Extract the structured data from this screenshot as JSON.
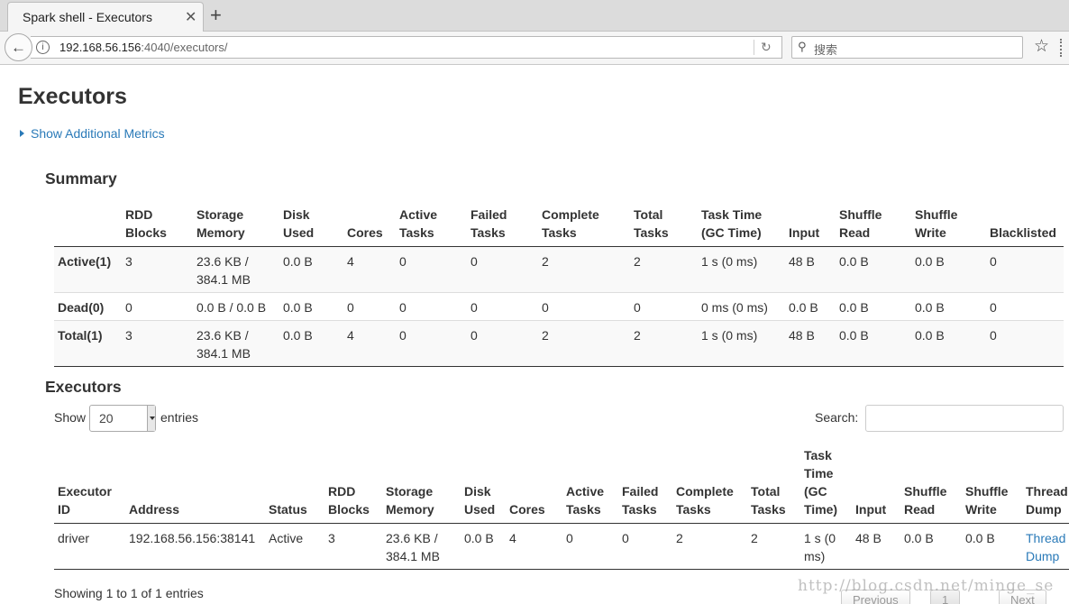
{
  "browser": {
    "tab_title": "Spark shell - Executors",
    "tab_close": "✕",
    "new_tab": "+",
    "url_host": "192.168.56.156",
    "url_path": ":4040/executors/",
    "search_placeholder": "搜索"
  },
  "page": {
    "title": "Executors",
    "show_additional_metrics": "Show Additional Metrics"
  },
  "summary": {
    "title": "Summary",
    "headers": [
      [
        "",
        ""
      ],
      [
        "RDD",
        "Blocks"
      ],
      [
        "Storage",
        "Memory"
      ],
      [
        "Disk",
        "Used"
      ],
      [
        "",
        "Cores"
      ],
      [
        "Active",
        "Tasks"
      ],
      [
        "Failed",
        "Tasks"
      ],
      [
        "Complete",
        "Tasks"
      ],
      [
        "Total",
        "Tasks"
      ],
      [
        "Task Time",
        "(GC Time)"
      ],
      [
        "",
        "Input"
      ],
      [
        "Shuffle",
        "Read"
      ],
      [
        "Shuffle",
        "Write"
      ],
      [
        "",
        "Blacklisted"
      ]
    ],
    "rows": [
      [
        "Active(1)",
        "3",
        "23.6 KB / 384.1 MB",
        "0.0 B",
        "4",
        "0",
        "0",
        "2",
        "2",
        "1 s (0 ms)",
        "48 B",
        "0.0 B",
        "0.0 B",
        "0"
      ],
      [
        "Dead(0)",
        "0",
        "0.0 B / 0.0 B",
        "0.0 B",
        "0",
        "0",
        "0",
        "0",
        "0",
        "0 ms (0 ms)",
        "0.0 B",
        "0.0 B",
        "0.0 B",
        "0"
      ],
      [
        "Total(1)",
        "3",
        "23.6 KB / 384.1 MB",
        "0.0 B",
        "4",
        "0",
        "0",
        "2",
        "2",
        "1 s (0 ms)",
        "48 B",
        "0.0 B",
        "0.0 B",
        "0"
      ]
    ]
  },
  "executors": {
    "title": "Executors",
    "show_label": "Show",
    "entries_value": "20",
    "entries_label": "entries",
    "search_label": "Search:",
    "headers": [
      [
        "Executor",
        "ID"
      ],
      [
        "Address"
      ],
      [
        "Status"
      ],
      [
        "RDD",
        "Blocks"
      ],
      [
        "Storage",
        "Memory"
      ],
      [
        "Disk",
        "Used"
      ],
      [
        "Cores"
      ],
      [
        "Active",
        "Tasks"
      ],
      [
        "Failed",
        "Tasks"
      ],
      [
        "Complete",
        "Tasks"
      ],
      [
        "Total",
        "Tasks"
      ],
      [
        "Task",
        "Time",
        "(GC",
        "Time)"
      ],
      [
        "Input"
      ],
      [
        "Shuffle",
        "Read"
      ],
      [
        "Shuffle",
        "Write"
      ],
      [
        "Thread",
        "Dump"
      ]
    ],
    "rows": [
      [
        "driver",
        "192.168.56.156:38141",
        "Active",
        "3",
        "23.6 KB / 384.1 MB",
        "0.0 B",
        "4",
        "0",
        "0",
        "2",
        "2",
        "1 s (0 ms)",
        "48 B",
        "0.0 B",
        "0.0 B",
        "Thread Dump"
      ]
    ],
    "showing_text": "Showing 1 to 1 of 1 entries",
    "pagination": {
      "previous": "Previous",
      "page": "1",
      "next": "Next"
    }
  },
  "watermark": "http://blog.csdn.net/minge_se"
}
